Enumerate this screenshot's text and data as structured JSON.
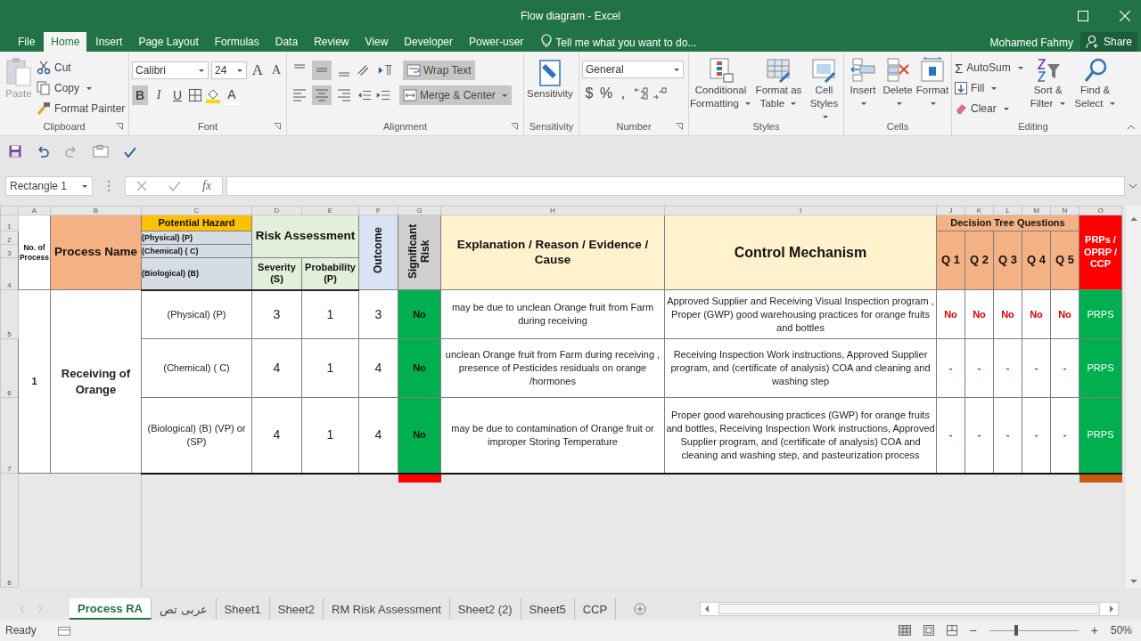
{
  "window": {
    "title": "Flow diagram - Excel",
    "user": "Mohamed Fahmy",
    "share": "Share"
  },
  "menu_tabs": [
    {
      "label": "File",
      "selected": false
    },
    {
      "label": "Home",
      "selected": true
    },
    {
      "label": "Insert",
      "selected": false
    },
    {
      "label": "Page Layout",
      "selected": false
    },
    {
      "label": "Formulas",
      "selected": false
    },
    {
      "label": "Data",
      "selected": false
    },
    {
      "label": "Review",
      "selected": false
    },
    {
      "label": "View",
      "selected": false
    },
    {
      "label": "Developer",
      "selected": false
    },
    {
      "label": "Power-user",
      "selected": false
    }
  ],
  "tell_me": "Tell me what you want to do...",
  "ribbon": {
    "clipboard": {
      "name": "Clipboard",
      "paste": "Paste",
      "cut": "Cut",
      "copy": "Copy",
      "format_painter": "Format Painter"
    },
    "font": {
      "name": "Font",
      "family": "Calibri",
      "size": "24",
      "grow": "A",
      "shrink": "A",
      "styles": [
        {
          "glyph": "B",
          "selected": true
        },
        {
          "glyph": "I",
          "selected": false
        },
        {
          "glyph": "U",
          "selected": false
        }
      ],
      "font_color": "A"
    },
    "alignment": {
      "name": "Alignment",
      "vertical": [
        {
          "selected": false
        },
        {
          "selected": true
        },
        {
          "selected": false
        }
      ],
      "horizontal": [
        {
          "selected": false
        },
        {
          "selected": true
        },
        {
          "selected": false
        }
      ],
      "wrap_text": {
        "label": "Wrap Text",
        "selected": true
      },
      "merge": {
        "label": "Merge & Center",
        "selected": true
      }
    },
    "sensitivity": {
      "name": "Sensitivity",
      "button": "Sensitivity"
    },
    "number": {
      "name": "Number",
      "format": "General",
      "currency": "$",
      "percent": "%",
      "comma": ","
    },
    "styles": {
      "name": "Styles",
      "buttons": [
        {
          "kind": "conditional",
          "label": "Conditional Formatting"
        },
        {
          "kind": "table",
          "label": "Format as Table"
        },
        {
          "kind": "cellstyles",
          "label": "Cell Styles"
        }
      ]
    },
    "cells": {
      "name": "Cells",
      "buttons": [
        {
          "kind": "insert",
          "label": "Insert"
        },
        {
          "kind": "delete",
          "label": "Delete"
        },
        {
          "kind": "format",
          "label": "Format"
        }
      ]
    },
    "editing": {
      "name": "Editing",
      "autosum_glyph": "Σ",
      "autosum": "AutoSum",
      "fill": "Fill",
      "clear": "Clear",
      "sort_filter": "Sort & Filter",
      "find_select": "Find & Select"
    }
  },
  "name_box": "Rectangle 1",
  "formula_label": "fx",
  "columns": [
    "A",
    "B",
    "C",
    "D",
    "E",
    "F",
    "G",
    "H",
    "I",
    "J",
    "K",
    "L",
    "M",
    "N",
    "O"
  ],
  "row_numbers": [
    "1",
    "2",
    "3",
    "4",
    "5",
    "6",
    "7",
    "8"
  ],
  "header": {
    "no_of_process": "No. of Process",
    "process_name": "Process Name",
    "potential_hazard": "Potential Hazard",
    "hazard_types": [
      "(Physical)  (P)",
      "(Chemical)  (  C)",
      "(Biological)  (B)"
    ],
    "risk_assessment": "Risk Assessment",
    "severity": "Severity (S)",
    "probability": "Probability (P)",
    "outcome": "Outcome",
    "significant_risk": "Significant Risk",
    "explanation": "Explanation / Reason / Evidence / Cause",
    "control": "Control Mechanism",
    "decision_tree": "Decision Tree Questions",
    "questions": [
      "Q 1",
      "Q 2",
      "Q 3",
      "Q 4",
      "Q 5"
    ],
    "result": "PRPs / OPRP / CCP"
  },
  "process": {
    "number": "1",
    "name": "Receiving of Orange",
    "hazards": [
      {
        "hazard": "(Physical)  (P)",
        "severity": "3",
        "probability": "1",
        "outcome": "3",
        "significant": "No",
        "explanation": "may be due to unclean Orange fruit from Farm during receiving",
        "control": "Approved Supplier and Receiving Visual Inspection program , Proper (GWP) good warehousing practices for orange fruits and bottles",
        "answers": [
          "No",
          "No",
          "No",
          "No",
          "No"
        ],
        "result": "PRPS"
      },
      {
        "hazard": "(Chemical)  ( C)",
        "severity": "4",
        "probability": "1",
        "outcome": "4",
        "significant": "No",
        "explanation": "unclean Orange fruit from Farm during receiving , presence of Pesticides residuals on orange /hormones",
        "control": "Receiving Inspection Work instructions, Approved Supplier program, and (certificate of analysis) COA and cleaning and washing step",
        "answers": [
          "-",
          "-",
          "-",
          "-",
          "-"
        ],
        "result": "PRPS"
      },
      {
        "hazard": "(Biological)  (B)  (VP) or (SP)",
        "severity": "4",
        "probability": "1",
        "outcome": "4",
        "significant": "No",
        "explanation": "may be due to contamination of  Orange fruit or improper Storing Temperature",
        "control": "Proper good warehousing practices (GWP) for orange fruits and bottles, Receiving Inspection Work instructions, Approved Supplier program, and (certificate of analysis) COA and cleaning and washing step, and pasteurization process",
        "answers": [
          "-",
          "-",
          "-",
          "-",
          "-"
        ],
        "result": "PRPS"
      }
    ]
  },
  "sheet_tabs": [
    {
      "label": "Process RA",
      "selected": true
    },
    {
      "label": "عربى تص",
      "selected": false
    },
    {
      "label": "Sheet1",
      "selected": false
    },
    {
      "label": "Sheet2",
      "selected": false
    },
    {
      "label": "RM Risk Assessment",
      "selected": false
    },
    {
      "label": "Sheet2 (2)",
      "selected": false
    },
    {
      "label": "Sheet5",
      "selected": false
    },
    {
      "label": "CCP",
      "selected": false
    }
  ],
  "status": {
    "text": "Ready",
    "zoom_out": "−",
    "zoom_in": "+",
    "zoom": "50%",
    "level": 0.3
  }
}
